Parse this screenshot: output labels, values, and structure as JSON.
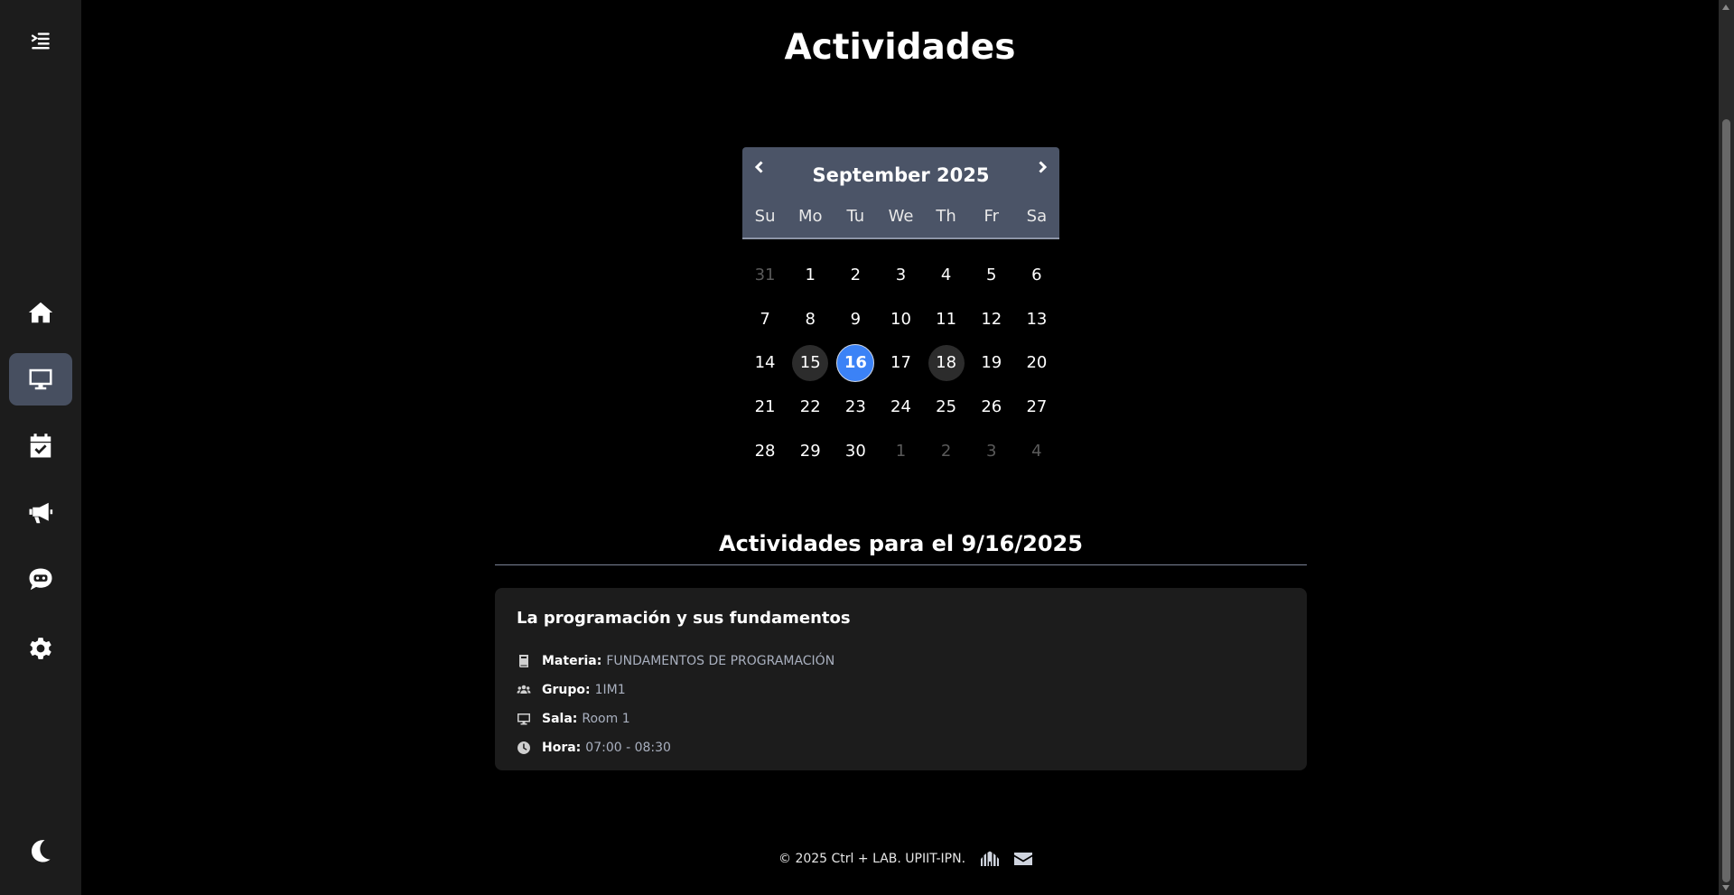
{
  "page": {
    "title": "Actividades"
  },
  "sidebar": {
    "items": [
      {
        "name": "home",
        "icon": "home-icon"
      },
      {
        "name": "computer",
        "icon": "desktop-icon",
        "active": true
      },
      {
        "name": "calendar",
        "icon": "calendar-check-icon"
      },
      {
        "name": "announcements",
        "icon": "megaphone-icon"
      },
      {
        "name": "chat",
        "icon": "chat-robot-icon"
      },
      {
        "name": "settings",
        "icon": "gear-icon"
      }
    ],
    "bottom_icon": "moon-icon"
  },
  "calendar": {
    "month_label": "September 2025",
    "weekdays": [
      "Su",
      "Mo",
      "Tu",
      "We",
      "Th",
      "Fr",
      "Sa"
    ],
    "days": [
      {
        "n": "31",
        "muted": true
      },
      {
        "n": "1"
      },
      {
        "n": "2"
      },
      {
        "n": "3"
      },
      {
        "n": "4"
      },
      {
        "n": "5"
      },
      {
        "n": "6"
      },
      {
        "n": "7"
      },
      {
        "n": "8"
      },
      {
        "n": "9"
      },
      {
        "n": "10"
      },
      {
        "n": "11"
      },
      {
        "n": "12"
      },
      {
        "n": "13"
      },
      {
        "n": "14"
      },
      {
        "n": "15",
        "hl": true
      },
      {
        "n": "16",
        "sel": true
      },
      {
        "n": "17"
      },
      {
        "n": "18",
        "hl": true
      },
      {
        "n": "19"
      },
      {
        "n": "20"
      },
      {
        "n": "21"
      },
      {
        "n": "22"
      },
      {
        "n": "23"
      },
      {
        "n": "24"
      },
      {
        "n": "25"
      },
      {
        "n": "26"
      },
      {
        "n": "27"
      },
      {
        "n": "28"
      },
      {
        "n": "29"
      },
      {
        "n": "30"
      },
      {
        "n": "1",
        "muted": true
      },
      {
        "n": "2",
        "muted": true
      },
      {
        "n": "3",
        "muted": true
      },
      {
        "n": "4",
        "muted": true
      }
    ],
    "selected_color": "#3b82f6"
  },
  "activities": {
    "heading": "Actividades para el 9/16/2025",
    "items": [
      {
        "title": "La programación y sus fundamentos",
        "materia_label": "Materia:",
        "materia": "FUNDAMENTOS DE PROGRAMACIÓN",
        "grupo_label": "Grupo:",
        "grupo": "1IM1",
        "sala_label": "Sala:",
        "sala": "Room 1",
        "hora_label": "Hora:",
        "hora": "07:00 - 08:30"
      }
    ]
  },
  "footer": {
    "text": "© 2025 Ctrl + LAB. UPIIT-IPN."
  }
}
